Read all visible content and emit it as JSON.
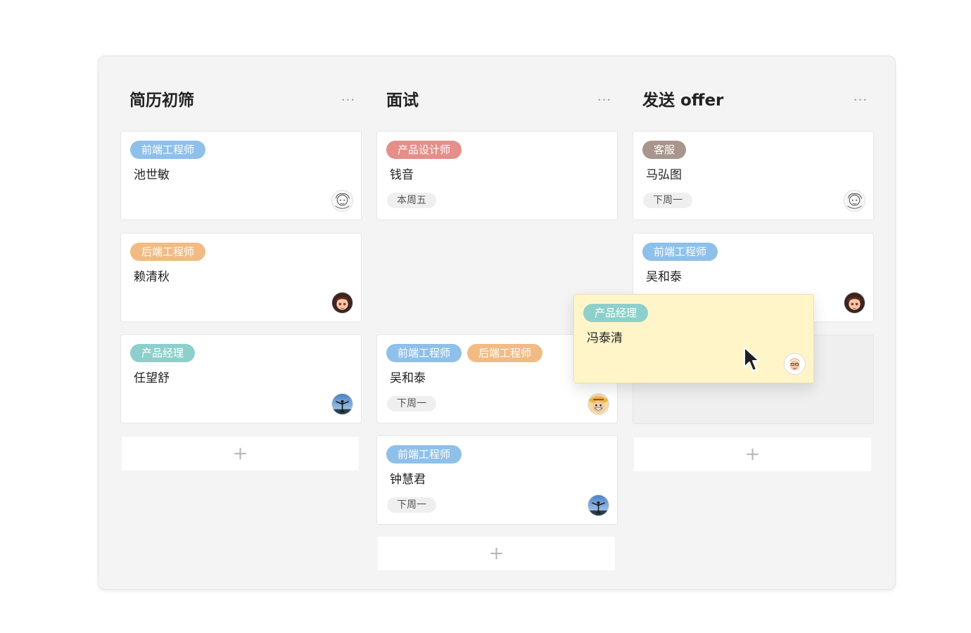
{
  "columns": [
    {
      "title": "简历初筛",
      "more": "···",
      "cards": [
        {
          "tags": [
            {
              "label": "前端工程师",
              "color": "#8ec0ea"
            }
          ],
          "name": "池世敏",
          "date": "",
          "avatar": "sketch-face"
        },
        {
          "tags": [
            {
              "label": "后端工程师",
              "color": "#f2bb84"
            }
          ],
          "name": "赖清秋",
          "date": "",
          "avatar": "anime-boy"
        },
        {
          "tags": [
            {
              "label": "产品经理",
              "color": "#8dd0cb"
            }
          ],
          "name": "任望舒",
          "date": "",
          "avatar": "sky-person"
        }
      ],
      "add_label": "+"
    },
    {
      "title": "面试",
      "more": "···",
      "cards": [
        {
          "tags": [
            {
              "label": "产品设计师",
              "color": "#e58e8a"
            }
          ],
          "name": "钱音",
          "date": "本周五",
          "avatar": ""
        },
        {
          "tags": [
            {
              "label": "前端工程师",
              "color": "#8ec0ea"
            },
            {
              "label": "后端工程师",
              "color": "#f2bb84"
            }
          ],
          "name": "吴和泰",
          "date": "下周一",
          "avatar": "straw-hat"
        },
        {
          "tags": [
            {
              "label": "前端工程师",
              "color": "#8ec0ea"
            }
          ],
          "name": "钟慧君",
          "date": "下周一",
          "avatar": "sky-person"
        }
      ],
      "add_label": "+"
    },
    {
      "title": "发送 offer",
      "more": "···",
      "cards": [
        {
          "tags": [
            {
              "label": "客服",
              "color": "#a8958e"
            }
          ],
          "name": "马弘图",
          "date": "下周一",
          "avatar": "sketch-face"
        },
        {
          "tags": [
            {
              "label": "前端工程师",
              "color": "#8ec0ea"
            }
          ],
          "name": "吴和泰",
          "date": "",
          "avatar": "anime-boy"
        }
      ],
      "add_label": "+"
    }
  ],
  "dragging_card": {
    "tags": [
      {
        "label": "产品经理",
        "color": "#8dd0cb"
      }
    ],
    "name": "冯泰清",
    "avatar": "cartoon-face"
  }
}
